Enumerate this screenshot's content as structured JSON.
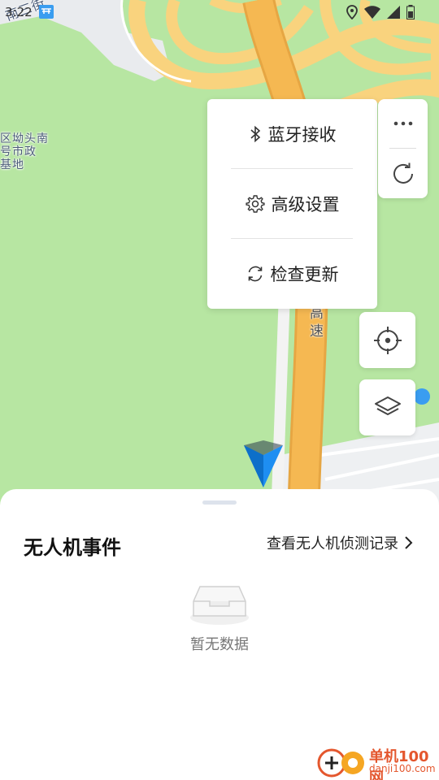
{
  "status_bar": {
    "time": "3:22",
    "icons": [
      "drone-app-icon",
      "location-icon",
      "wifi-icon",
      "signal-icon",
      "battery-icon"
    ]
  },
  "map": {
    "labels": {
      "district_line1": "区坳头南",
      "district_line2": "号市政",
      "district_line3": "基地",
      "road_top": "南三街",
      "highway_1": "高",
      "highway_2": "速"
    }
  },
  "popup_menu": {
    "items": [
      {
        "label": "蓝牙接收",
        "icon": "bluetooth-icon"
      },
      {
        "label": "高级设置",
        "icon": "gear-icon"
      },
      {
        "label": "检查更新",
        "icon": "refresh-icon"
      }
    ]
  },
  "controls": {
    "more": "more-icon",
    "refresh": "refresh-icon",
    "locate": "crosshair-icon",
    "layers": "layers-icon"
  },
  "sheet": {
    "title": "无人机事件",
    "record_link": "查看无人机侦测记录",
    "empty_text": "暂无数据"
  },
  "watermark": {
    "line1": "单机100网",
    "line2": "danji100.com"
  },
  "colors": {
    "map_green": "#b7e6a2",
    "road_yellow": "#f9d37e",
    "road_orange": "#f4b451",
    "arrow_blue": "#1e8ef2",
    "watermark_red": "#e4572e"
  }
}
